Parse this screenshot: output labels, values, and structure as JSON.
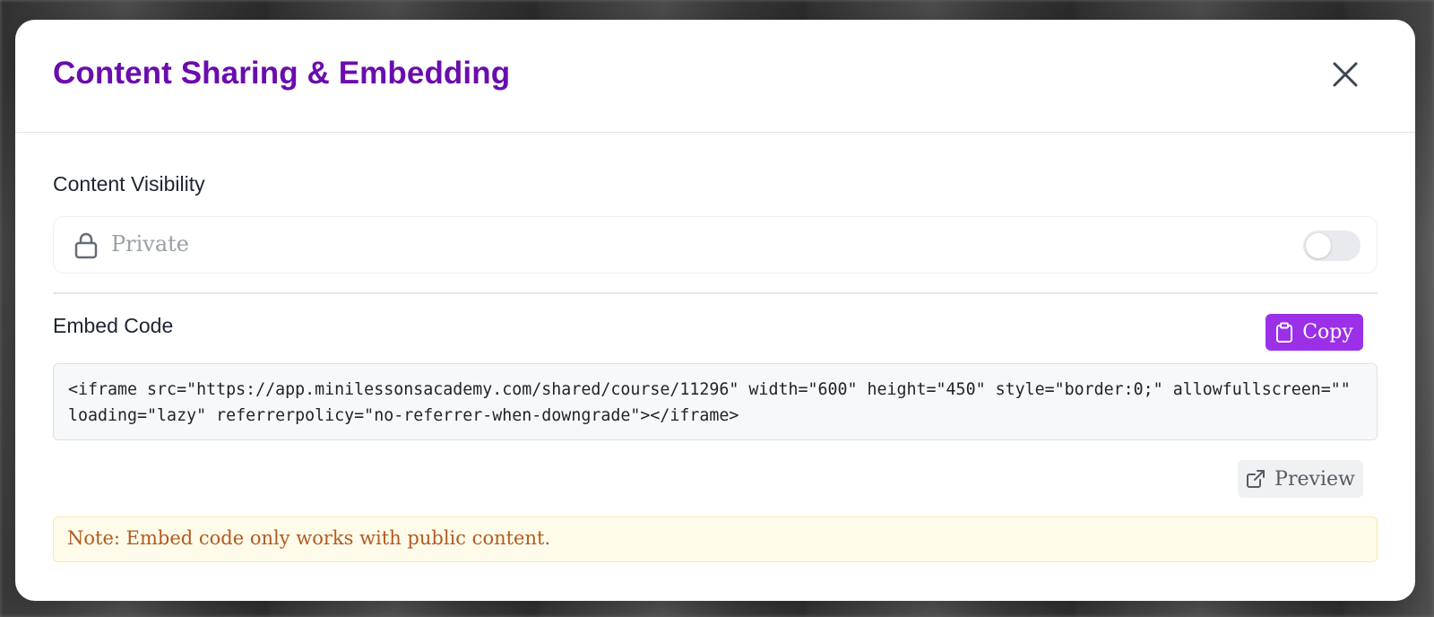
{
  "modal": {
    "title": "Content Sharing & Embedding"
  },
  "visibility": {
    "label": "Content Visibility",
    "value": "Private",
    "toggle_on": false
  },
  "embed": {
    "label": "Embed Code",
    "copy_label": "Copy",
    "code": "<iframe src=\"https://app.minilessonsacademy.com/shared/course/11296\" width=\"600\" height=\"450\" style=\"border:0;\" allowfullscreen=\"\" loading=\"lazy\" referrerpolicy=\"no-referrer-when-downgrade\"></iframe>",
    "preview_label": "Preview"
  },
  "note": {
    "text": "Note: Embed code only works with public content."
  },
  "icons": {
    "close": "close-icon",
    "lock": "lock-icon",
    "clipboard": "clipboard-icon",
    "external_link": "external-link-icon"
  },
  "colors": {
    "title": "#6a0dad",
    "primary_button": "#9b30e8",
    "note_text": "#b35a1d",
    "note_bg": "#fffbeb"
  }
}
